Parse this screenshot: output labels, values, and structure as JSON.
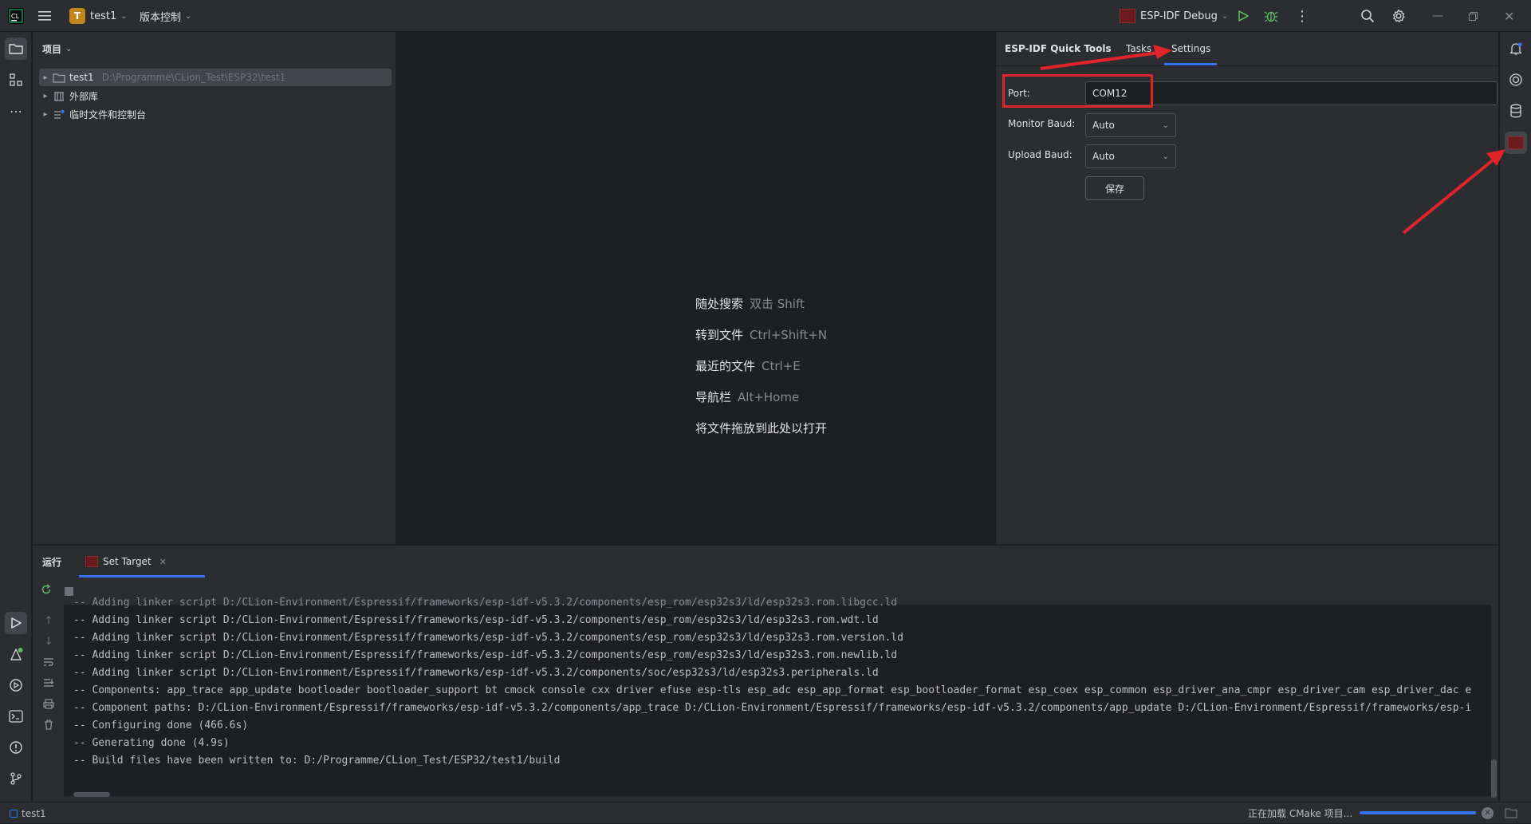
{
  "titlebar": {
    "project_initial": "T",
    "project_name": "test1",
    "vcs_label": "版本控制",
    "run_config": "ESP-IDF Debug"
  },
  "project_panel": {
    "title": "项目",
    "items": [
      {
        "label": "test1",
        "path": "D:\\Programme\\CLion_Test\\ESP32\\test1"
      },
      {
        "label": "外部库",
        "path": ""
      },
      {
        "label": "临时文件和控制台",
        "path": ""
      }
    ]
  },
  "editor_hints": [
    {
      "label": "随处搜索",
      "shortcut": "双击 Shift"
    },
    {
      "label": "转到文件",
      "shortcut": "Ctrl+Shift+N"
    },
    {
      "label": "最近的文件",
      "shortcut": "Ctrl+E"
    },
    {
      "label": "导航栏",
      "shortcut": "Alt+Home"
    },
    {
      "label": "将文件拖放到此处以打开",
      "shortcut": ""
    }
  ],
  "quick_tools": {
    "title": "ESP-IDF Quick Tools",
    "tabs": [
      "Tasks",
      "Settings"
    ],
    "active_tab": "Settings",
    "port_label": "Port:",
    "port_value": "COM12",
    "monitor_baud_label": "Monitor Baud:",
    "monitor_baud_value": "Auto",
    "upload_baud_label": "Upload Baud:",
    "upload_baud_value": "Auto",
    "save_label": "保存"
  },
  "run_panel": {
    "title": "运行",
    "tab_label": "Set Target",
    "console_lines": [
      "-- Adding linker script D:/CLion-Environment/Espressif/frameworks/esp-idf-v5.3.2/components/esp_rom/esp32s3/ld/esp32s3.rom.libgcc.ld",
      "-- Adding linker script D:/CLion-Environment/Espressif/frameworks/esp-idf-v5.3.2/components/esp_rom/esp32s3/ld/esp32s3.rom.wdt.ld",
      "-- Adding linker script D:/CLion-Environment/Espressif/frameworks/esp-idf-v5.3.2/components/esp_rom/esp32s3/ld/esp32s3.rom.version.ld",
      "-- Adding linker script D:/CLion-Environment/Espressif/frameworks/esp-idf-v5.3.2/components/esp_rom/esp32s3/ld/esp32s3.rom.newlib.ld",
      "-- Adding linker script D:/CLion-Environment/Espressif/frameworks/esp-idf-v5.3.2/components/soc/esp32s3/ld/esp32s3.peripherals.ld",
      "-- Components: app_trace app_update bootloader bootloader_support bt cmock console cxx driver efuse esp-tls esp_adc esp_app_format esp_bootloader_format esp_coex esp_common esp_driver_ana_cmpr esp_driver_cam esp_driver_dac e",
      "-- Component paths: D:/CLion-Environment/Espressif/frameworks/esp-idf-v5.3.2/components/app_trace D:/CLion-Environment/Espressif/frameworks/esp-idf-v5.3.2/components/app_update D:/CLion-Environment/Espressif/frameworks/esp-i",
      "-- Configuring done (466.6s)",
      "-- Generating done (4.9s)",
      "-- Build files have been written to: D:/Programme/CLion_Test/ESP32/test1/build"
    ]
  },
  "statusbar": {
    "project": "test1",
    "progress_text": "正在加载 CMake 项目...",
    "progress": 1.0
  },
  "colors": {
    "accent": "#3574f0",
    "annotation_red": "#e0242a",
    "run_green": "#5fb865"
  },
  "icons": [
    "menu-icon",
    "run-icon",
    "debug-icon",
    "more-icon",
    "search-icon",
    "gear-icon",
    "folder-icon",
    "structure-icon",
    "bell-icon",
    "database-icon",
    "esp-icon"
  ]
}
